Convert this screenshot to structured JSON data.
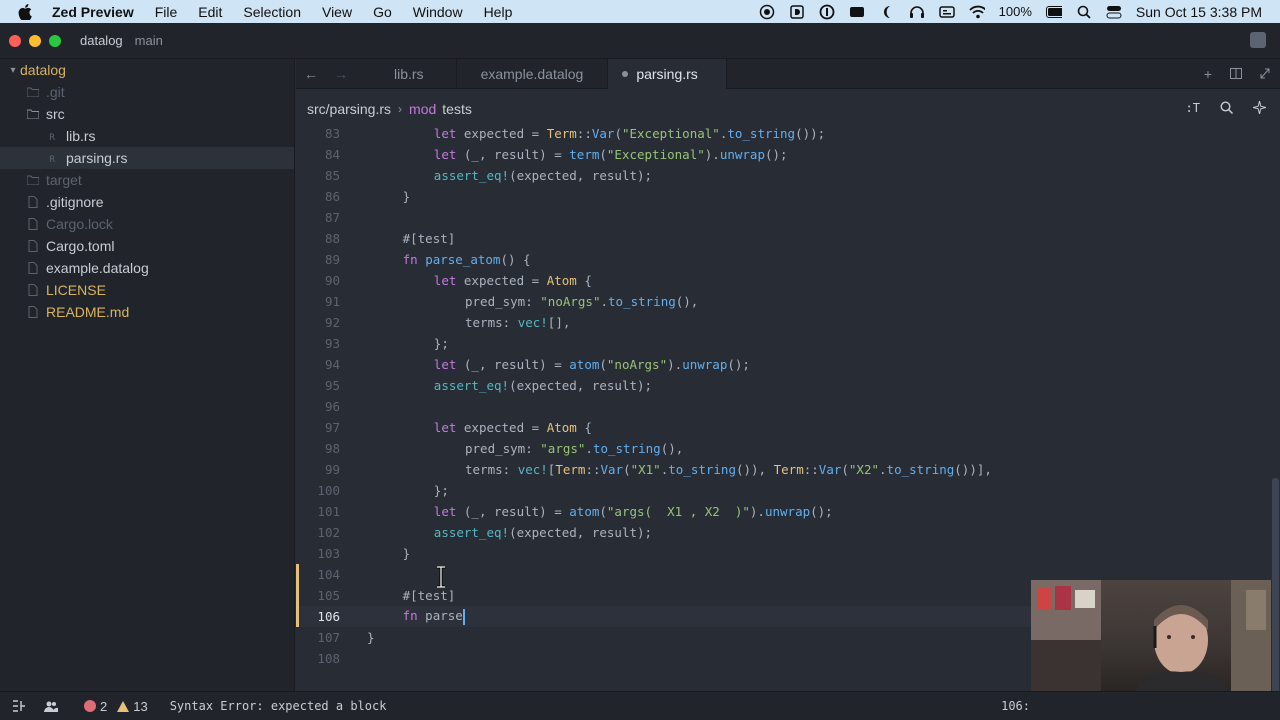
{
  "menubar": {
    "app_name": "Zed Preview",
    "items": [
      "File",
      "Edit",
      "Selection",
      "View",
      "Go",
      "Window",
      "Help"
    ],
    "battery": "100%",
    "datetime": "Sun Oct 15  3:38 PM"
  },
  "titlebar": {
    "project": "datalog",
    "branch": "main"
  },
  "sidebar": {
    "items": [
      {
        "label": "datalog",
        "kind": "folder-open",
        "style": "yellow"
      },
      {
        "label": ".git",
        "kind": "folder",
        "style": "muted"
      },
      {
        "label": "src",
        "kind": "folder-open",
        "style": "normal"
      },
      {
        "label": "lib.rs",
        "kind": "rust-file",
        "style": "normal"
      },
      {
        "label": "parsing.rs",
        "kind": "rust-file",
        "style": "normal",
        "selected": true
      },
      {
        "label": "target",
        "kind": "folder",
        "style": "muted"
      },
      {
        "label": ".gitignore",
        "kind": "file",
        "style": "normal"
      },
      {
        "label": "Cargo.lock",
        "kind": "file",
        "style": "muted"
      },
      {
        "label": "Cargo.toml",
        "kind": "file",
        "style": "normal"
      },
      {
        "label": "example.datalog",
        "kind": "file",
        "style": "normal"
      },
      {
        "label": "LICENSE",
        "kind": "file",
        "style": "yellow"
      },
      {
        "label": "README.md",
        "kind": "file",
        "style": "yellow"
      }
    ]
  },
  "tabs": {
    "items": [
      {
        "label": "lib.rs",
        "active": false
      },
      {
        "label": "example.datalog",
        "active": false
      },
      {
        "label": "parsing.rs",
        "active": true
      }
    ]
  },
  "breadcrumb": {
    "path": "src/parsing.rs",
    "keyword": "mod",
    "module": "tests"
  },
  "editor": {
    "lines": [
      {
        "n": "83",
        "code": "let expected = Term::Var(\"Exceptional\".to_string());"
      },
      {
        "n": "84",
        "code": "let (_, result) = term(\"Exceptional\").unwrap();"
      },
      {
        "n": "85",
        "code": "assert_eq!(expected, result);"
      },
      {
        "n": "86",
        "code": "}"
      },
      {
        "n": "87",
        "code": ""
      },
      {
        "n": "88",
        "code": "#[test]"
      },
      {
        "n": "89",
        "code": "fn parse_atom() {"
      },
      {
        "n": "90",
        "code": "let expected = Atom {"
      },
      {
        "n": "91",
        "code": "pred_sym: \"noArgs\".to_string(),"
      },
      {
        "n": "92",
        "code": "terms: vec![],"
      },
      {
        "n": "93",
        "code": "};"
      },
      {
        "n": "94",
        "code": "let (_, result) = atom(\"noArgs\").unwrap();"
      },
      {
        "n": "95",
        "code": "assert_eq!(expected, result);"
      },
      {
        "n": "96",
        "code": ""
      },
      {
        "n": "97",
        "code": "let expected = Atom {"
      },
      {
        "n": "98",
        "code": "pred_sym: \"args\".to_string(),"
      },
      {
        "n": "99",
        "code": "terms: vec![Term::Var(\"X1\".to_string()), Term::Var(\"X2\".to_string())],"
      },
      {
        "n": "100",
        "code": "};"
      },
      {
        "n": "101",
        "code": "let (_, result) = atom(\"args(  X1 , X2  )\").unwrap();"
      },
      {
        "n": "102",
        "code": "assert_eq!(expected, result);"
      },
      {
        "n": "103",
        "code": "}"
      },
      {
        "n": "104",
        "code": ""
      },
      {
        "n": "105",
        "code": "#[test]"
      },
      {
        "n": "106",
        "code": "fn parse"
      },
      {
        "n": "107",
        "code": "}"
      },
      {
        "n": "108",
        "code": ""
      }
    ]
  },
  "statusbar": {
    "errors": "2",
    "warnings": "13",
    "message": "Syntax Error: expected a block",
    "position": "106:"
  },
  "colors": {
    "keyword": "#c678dd",
    "function": "#61afef",
    "string": "#98c379",
    "type": "#e5c07b",
    "macro": "#56b6c2",
    "error": "#e06c75",
    "warning": "#e5c07b"
  }
}
